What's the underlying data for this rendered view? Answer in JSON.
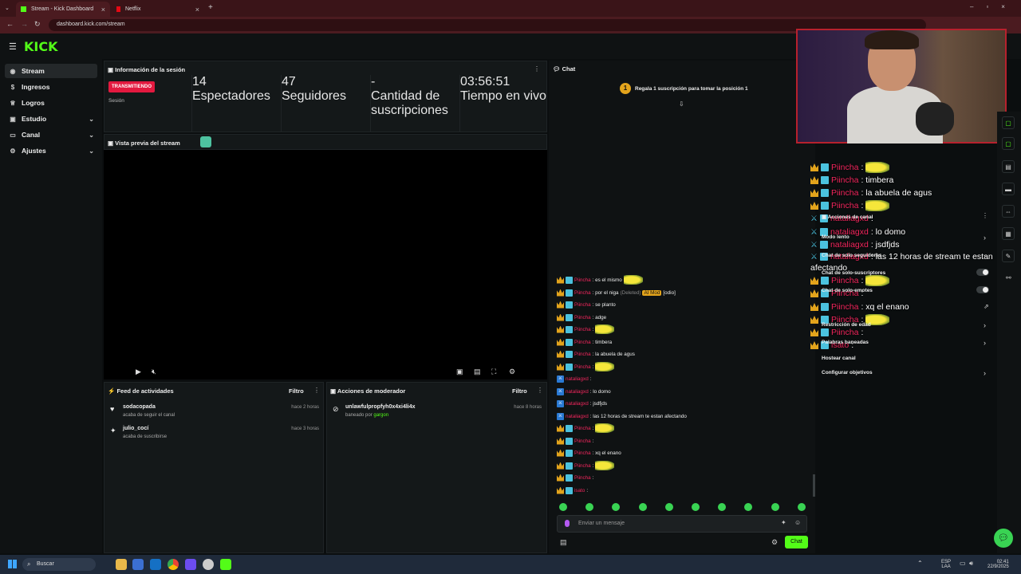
{
  "browser": {
    "tabs": [
      {
        "title": "Stream - Kick Dashboard",
        "active": true
      },
      {
        "title": "Netflix",
        "active": false
      }
    ],
    "url": "dashboard.kick.com/stream"
  },
  "app": {
    "logo": "KICK"
  },
  "sidebar": {
    "items": [
      {
        "label": "Stream",
        "icon": "broadcast-icon",
        "selected": true
      },
      {
        "label": "Ingresos",
        "icon": "money-icon"
      },
      {
        "label": "Logros",
        "icon": "trophy-icon"
      },
      {
        "label": "Estudio",
        "icon": "video-icon",
        "expandable": true
      },
      {
        "label": "Canal",
        "icon": "tv-icon",
        "expandable": true
      },
      {
        "label": "Ajustes",
        "icon": "gear-icon",
        "expandable": true
      }
    ]
  },
  "session": {
    "title": "Información de la sesión",
    "badge": "TRANSMITIENDO",
    "badge_label": "Sesión",
    "stats": [
      {
        "value": "14",
        "label": "Espectadores"
      },
      {
        "value": "47",
        "label": "Seguidores"
      },
      {
        "value": "-",
        "label": "Cantidad de suscripciones"
      },
      {
        "value": "03:56:51",
        "label": "Tiempo en vivo"
      }
    ]
  },
  "preview": {
    "title": "Vista previa del stream"
  },
  "activity": {
    "title": "Feed de actividades",
    "filter": "Filtro",
    "items": [
      {
        "name": "sodacopada",
        "desc": "acaba de seguir el canal",
        "time": "hace 2 horas"
      },
      {
        "name": "julio_cocí",
        "desc": "acaba de suscribirse",
        "time": "hace 3 horas"
      }
    ]
  },
  "modactions": {
    "title": "Acciones de moderador",
    "filter": "Filtro",
    "items": [
      {
        "name": "unlawfulpropfyh0x4xi4li4x",
        "desc": "baneado por",
        "by": "gargon",
        "time": "hace 8 horas"
      }
    ]
  },
  "chat": {
    "title": "Chat",
    "gift_prompt": "Regala 1 suscripción para tomar la posición 1",
    "messages": [
      {
        "user": "Piincha",
        "text": ": es el mismo",
        "emote": true,
        "kind": "sub"
      },
      {
        "user": "Piincha",
        "text": ": por el niga",
        "deleted": "(Deleted)",
        "tag": "AI Mod",
        "extra": "[odio]",
        "kind": "sub"
      },
      {
        "user": "Piincha",
        "text": ": se planto",
        "kind": "sub"
      },
      {
        "user": "Piincha",
        "text": ": adge",
        "kind": "sub"
      },
      {
        "user": "Piincha",
        "text": ":",
        "emote": true,
        "kind": "sub"
      },
      {
        "user": "Piincha",
        "text": ": timbera",
        "kind": "sub"
      },
      {
        "user": "Piincha",
        "text": ": la abuela de agus",
        "kind": "sub"
      },
      {
        "user": "Piincha",
        "text": ":",
        "emote": true,
        "kind": "sub"
      },
      {
        "user": "nataliagxd",
        "text": ":",
        "kind": "mod"
      },
      {
        "user": "nataliagxd",
        "text": ": lo domo",
        "kind": "mod"
      },
      {
        "user": "nataliagxd",
        "text": ": jsdfjds",
        "kind": "mod"
      },
      {
        "user": "nataliagxd",
        "text": ": las 12 horas de stream te estan afectando",
        "kind": "mod"
      },
      {
        "user": "Piincha",
        "text": ":",
        "emote": true,
        "kind": "sub"
      },
      {
        "user": "Piincha",
        "text": ":",
        "kind": "sub"
      },
      {
        "user": "Piincha",
        "text": ": xq el enano",
        "kind": "sub"
      },
      {
        "user": "Piincha",
        "text": ":",
        "emote": true,
        "kind": "sub"
      },
      {
        "user": "Piincha",
        "text": ":",
        "kind": "sub"
      },
      {
        "user": "isato",
        "text": ":",
        "kind": "sub"
      }
    ],
    "input_placeholder": "Enviar un mensaje",
    "send_label": "Chat"
  },
  "overlay": {
    "lines": [
      {
        "user": "Piincha",
        "text": ":",
        "emote": true
      },
      {
        "user": "Piincha",
        "text": ": timbera"
      },
      {
        "user": "Piincha",
        "text": ": la abuela de agus"
      },
      {
        "user": "Piincha",
        "text": ":",
        "emote": true
      },
      {
        "user": "nataliagxd",
        "text": ":"
      },
      {
        "user": "nataliagxd",
        "text": ": lo domo"
      },
      {
        "user": "nataliagxd",
        "text": ": jsdfjds"
      },
      {
        "user": "nataliagxd",
        "text": ": las 12 horas de stream te estan"
      },
      {
        "user": "",
        "text": "afectando"
      },
      {
        "user": "Piincha",
        "text": ":",
        "emote": true
      },
      {
        "user": "Piincha",
        "text": ":"
      },
      {
        "user": "Piincha",
        "text": ": xq el enano"
      },
      {
        "user": "Piincha",
        "text": ":",
        "emote": true
      },
      {
        "user": "Piincha",
        "text": ":"
      },
      {
        "user": "isato",
        "text": ":"
      }
    ]
  },
  "channel_actions": {
    "title": "Acciones de canal",
    "options": [
      {
        "label": "Modo lento",
        "control": "chevron"
      },
      {
        "label": "Chat de solo seguidores",
        "control": "chevron"
      },
      {
        "label": "Chat de solo-suscriptores",
        "control": "toggle"
      },
      {
        "label": "Chat de solo-emotes",
        "control": "toggle"
      },
      {
        "label": "Restricción de edad",
        "control": "chevron"
      },
      {
        "label": "Palabras baneadas",
        "control": "chevron"
      },
      {
        "label": "Hostear canal",
        "control": "none"
      },
      {
        "label": "Configurar objetivos",
        "control": "chevron"
      }
    ]
  },
  "taskbar": {
    "search": "Buscar",
    "lang": "ESP",
    "lang2": "LAA",
    "time": "02:41",
    "date": "22/9/2025"
  },
  "colors": {
    "brand": "#53fc18",
    "live": "#e3193f",
    "username": "#f2265d"
  }
}
